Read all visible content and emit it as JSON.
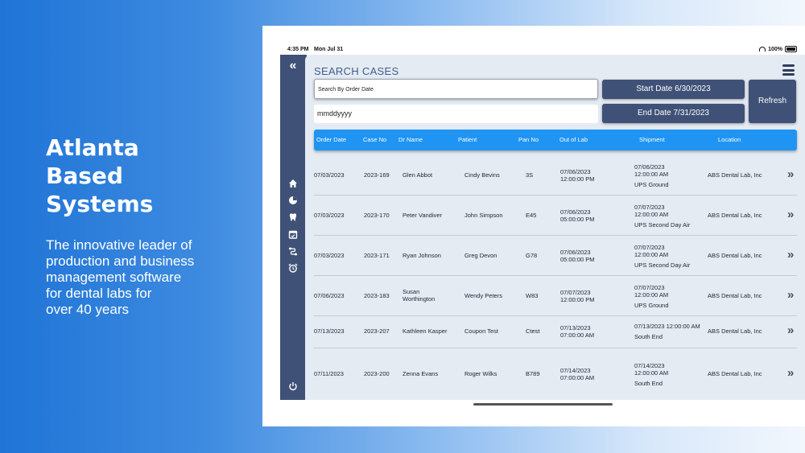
{
  "hero": {
    "title": [
      "Atlanta",
      "Based",
      "Systems"
    ],
    "subtitle": [
      "The innovative leader of",
      "production and business",
      "management software",
      "for dental labs for",
      "over 40 years"
    ]
  },
  "status": {
    "time": "4:35 PM",
    "date": "Mon Jul 31",
    "battery": "100%"
  },
  "sidebar": {
    "collapse_icon": "double-chevron-left-icon",
    "items": [
      "home-icon",
      "pie-chart-icon",
      "tooth-icon",
      "calendar-icon",
      "route-icon",
      "alarm-icon"
    ],
    "power_icon": "power-icon"
  },
  "page": {
    "title": "SEARCH CASES",
    "search_mode": "Search By Order Date",
    "date_placeholder": "mmddyyyy",
    "start_date_btn": "Start Date 6/30/2023",
    "end_date_btn": "End Date 7/31/2023",
    "refresh_btn": "Refresh"
  },
  "table": {
    "headers": [
      "Order Date",
      "Case No",
      "Dr Name",
      "Patient",
      "Pan No",
      "Out of Lab",
      "Shipment",
      "Location"
    ],
    "rows": [
      {
        "order_date": "07/03/2023",
        "case_no": "2023-169",
        "dr_name": [
          "Glen Abbot"
        ],
        "patient": "Cindy Bevins",
        "pan_no": "3S",
        "out_of_lab": [
          "07/06/2023",
          "12:00:00 PM"
        ],
        "shipment": [
          "07/06/2023",
          "12:00:00 AM",
          "UPS Ground"
        ],
        "location": "ABS Dental Lab, Inc"
      },
      {
        "order_date": "07/03/2023",
        "case_no": "2023-170",
        "dr_name": [
          "Peter Vandiver"
        ],
        "patient": "John Simpson",
        "pan_no": "E45",
        "out_of_lab": [
          "07/06/2023",
          "05:00:00 PM"
        ],
        "shipment": [
          "07/07/2023",
          "12:00:00 AM",
          "UPS Second Day Air"
        ],
        "location": "ABS Dental Lab, Inc"
      },
      {
        "order_date": "07/03/2023",
        "case_no": "2023-171",
        "dr_name": [
          "Ryan Johnson"
        ],
        "patient": "Greg Devon",
        "pan_no": "G78",
        "out_of_lab": [
          "07/06/2023",
          "05:00:00 PM"
        ],
        "shipment": [
          "07/07/2023",
          "12:00:00 AM",
          "UPS Second Day Air"
        ],
        "location": "ABS Dental Lab, Inc"
      },
      {
        "order_date": "07/06/2023",
        "case_no": "2023-183",
        "dr_name": [
          "Susan",
          "Worthington"
        ],
        "patient": "Wendy Peters",
        "pan_no": "W83",
        "out_of_lab": [
          "07/07/2023",
          "12:00:00 PM"
        ],
        "shipment": [
          "07/07/2023",
          "12:00:00 AM",
          "UPS Ground"
        ],
        "location": "ABS Dental Lab, Inc"
      },
      {
        "order_date": "07/13/2023",
        "case_no": "2023-207",
        "dr_name": [
          "Kathleen Kasper"
        ],
        "patient": "Coupon Test",
        "pan_no": "Ctest",
        "out_of_lab": [
          "07/13/2023",
          "07:00:00 AM"
        ],
        "shipment": [
          "07/13/2023 12:00:00 AM",
          "South End"
        ],
        "location": "ABS Dental Lab, Inc"
      },
      {
        "order_date": "07/11/2023",
        "case_no": "2023-200",
        "dr_name": [
          "Zenna Evans"
        ],
        "patient": "Roger Wilks",
        "pan_no": "B789",
        "out_of_lab": [
          "07/14/2023",
          "07:00:00 AM"
        ],
        "shipment": [
          "07/14/2023",
          "12:00:00 AM",
          "South End"
        ],
        "location": "ABS Dental Lab, Inc"
      }
    ],
    "row_icon": "chevron-right-icon"
  },
  "colors": {
    "sidebar": "#3f5176",
    "header": "#2094f3",
    "panel": "#e5ebf3",
    "title": "#3c5f8c"
  }
}
